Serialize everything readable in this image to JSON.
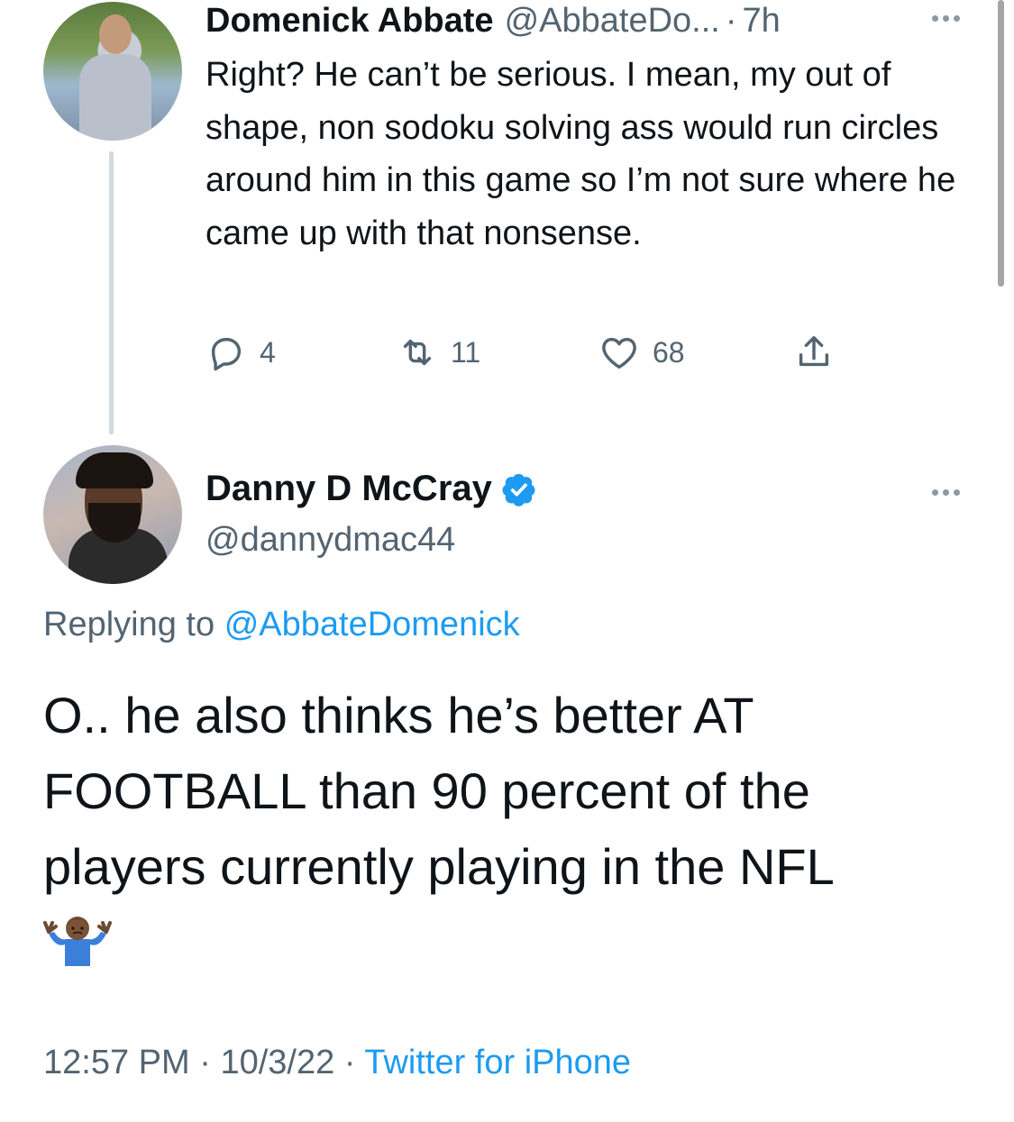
{
  "tweet1": {
    "author_name": "Domenick Abbate",
    "author_handle": "@AbbateDo...",
    "separator": "·",
    "time": "7h",
    "text": "Right? He can’t be serious. I mean, my out of shape, non sodoku solving ass would run circles around him in this game so I’m not sure where he came up with that nonsense.",
    "replies": "4",
    "retweets": "11",
    "likes": "68"
  },
  "tweet2": {
    "author_name": "Danny D McCray",
    "author_handle": "@dannydmac44",
    "replying_prefix": "Replying to",
    "replying_to": "@AbbateDomenick",
    "text": "O.. he also thinks he’s better AT FOOTBALL than 90 percent of the players currently playing in the NFL",
    "emoji": "person-shrugging-emoji",
    "time": "12:57 PM",
    "date": "10/3/22",
    "separator": "·",
    "source": "Twitter for iPhone"
  },
  "colors": {
    "text": "#0f1419",
    "secondary": "#536471",
    "link": "#1d9bf0",
    "verified": "#1d9bf0",
    "thread_line": "#cfd9de"
  },
  "icons": [
    "reply-icon",
    "retweet-icon",
    "like-icon",
    "share-icon",
    "more-icon",
    "verified-icon"
  ]
}
